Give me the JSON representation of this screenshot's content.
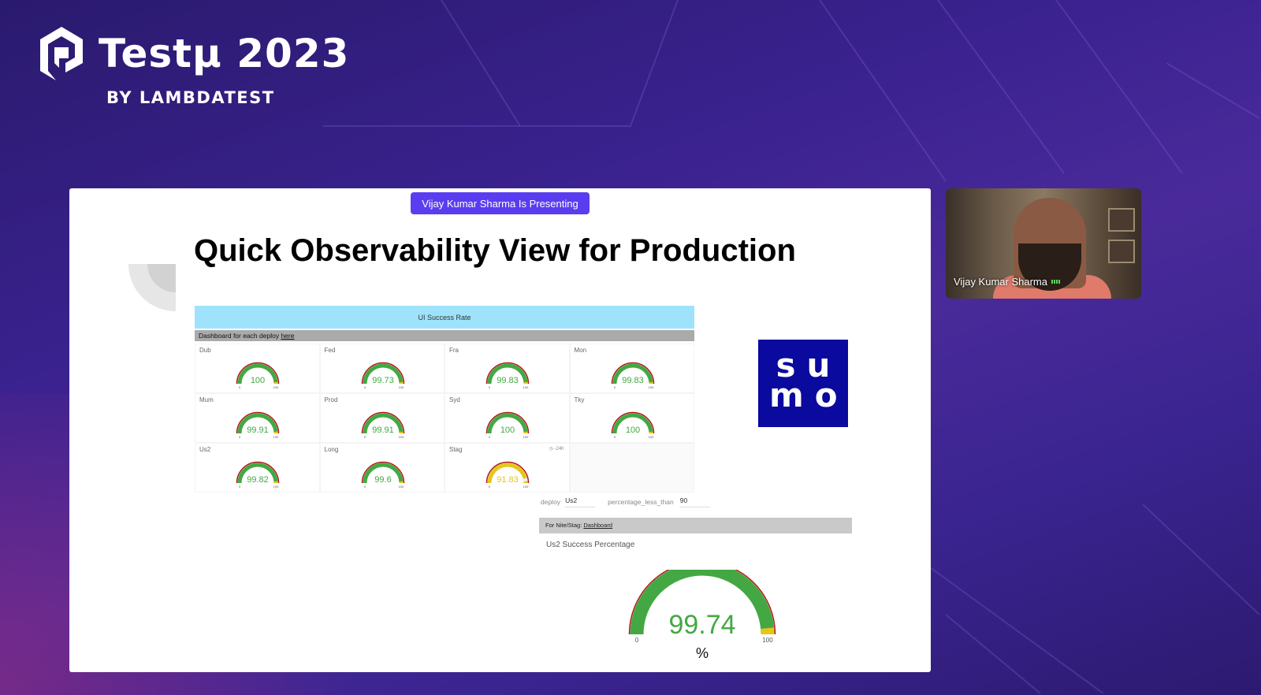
{
  "event": {
    "title": "Testμ 2023",
    "subtitle": "BY LAMBDATEST"
  },
  "presenting_badge": "Vijay Kumar Sharma Is Presenting",
  "slide": {
    "title": "Quick Observability View for Production",
    "dashboard": {
      "header": "UI Success Rate",
      "subheader_text": "Dashboard for each deploy ",
      "subheader_link": "here",
      "time_range": "◷ -24h",
      "gauge_min": "0",
      "gauge_max": "100",
      "gauges": [
        {
          "label": "Dub",
          "value": "100",
          "fraction": 1.0
        },
        {
          "label": "Fed",
          "value": "99.73",
          "fraction": 0.9973
        },
        {
          "label": "Fra",
          "value": "99.83",
          "fraction": 0.9983
        },
        {
          "label": "Mon",
          "value": "99.83",
          "fraction": 0.9983
        },
        {
          "label": "Mum",
          "value": "99.91",
          "fraction": 0.9991
        },
        {
          "label": "Prod",
          "value": "99.91",
          "fraction": 0.9991
        },
        {
          "label": "Syd",
          "value": "100",
          "fraction": 1.0
        },
        {
          "label": "Tky",
          "value": "100",
          "fraction": 1.0
        },
        {
          "label": "Us2",
          "value": "99.82",
          "fraction": 0.9982
        },
        {
          "label": "Long",
          "value": "99.6",
          "fraction": 0.996
        },
        {
          "label": "Stag",
          "value": "91.83",
          "fraction": 0.9183
        }
      ]
    },
    "params": {
      "deploy_label": "deploy",
      "deploy_value": "Us2",
      "threshold_label": "percentage_less_than",
      "threshold_value": "90"
    },
    "nite_bar": {
      "text": "For Nite/Stag: ",
      "link": "Dashboard"
    },
    "us2_panel": {
      "title": "Us2 Success Percentage",
      "value": "99.74",
      "fraction": 0.9974,
      "min": "0",
      "max": "100",
      "unit": "%"
    },
    "sumo_logo": "su mo"
  },
  "video": {
    "name": "Vijay Kumar Sharma"
  },
  "colors": {
    "green": "#43a843",
    "yellow": "#e6c619",
    "red": "#b01818",
    "badge": "#5a3df0",
    "sumo": "#0a0a9e"
  }
}
